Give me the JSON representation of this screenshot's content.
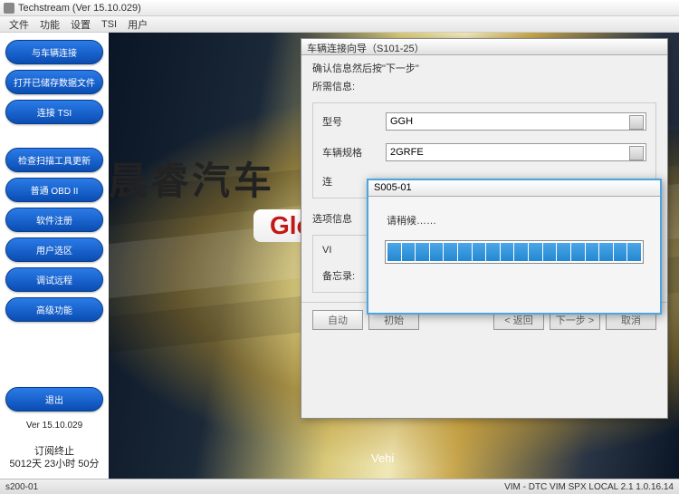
{
  "titlebar": {
    "text": "Techstream (Ver 15.10.029)"
  },
  "menu": [
    "文件",
    "功能",
    "设置",
    "TSI",
    "用户"
  ],
  "sidebar": {
    "connect": "与车辆连接",
    "open_file": "打开已储存数据文件",
    "tsi": "连接 TSI",
    "customize": "检查扫描工具更新",
    "obd2": "普通 OBD II",
    "register": "软件注册",
    "user_area": "用户选区",
    "remote": "调试远程",
    "advanced": "高级功能",
    "exit": "退出",
    "version": "Ver 15.10.029",
    "expiry_label": "订阅终止",
    "expiry_value": "5012天 23小时 50分"
  },
  "watermark": "晨睿汽车",
  "logo": "Globa",
  "vehi": "Vehi",
  "wizard": {
    "title": "车辆连接向导（S101-25）",
    "subtitle": "确认信息然后按\"下一步\"",
    "section": "所需信息:",
    "model_label": "型号",
    "model_value": "GGH",
    "engine_label": "车辆规格",
    "engine_value": "2GRFE",
    "conn_label": "连",
    "filter_label": "选项信息",
    "vin_label": "VI",
    "memo_label": "备忘录:",
    "btn_auto": "自动",
    "btn_reset": "初始",
    "btn_back": "< 返回",
    "btn_next": "下一步 >",
    "btn_cancel": "取消"
  },
  "progress": {
    "title": "S005-01",
    "text": "请稍候……"
  },
  "status": {
    "left": "s200-01",
    "right": "VIM - DTC VIM SPX LOCAL 2.1 1.0.16.14"
  }
}
